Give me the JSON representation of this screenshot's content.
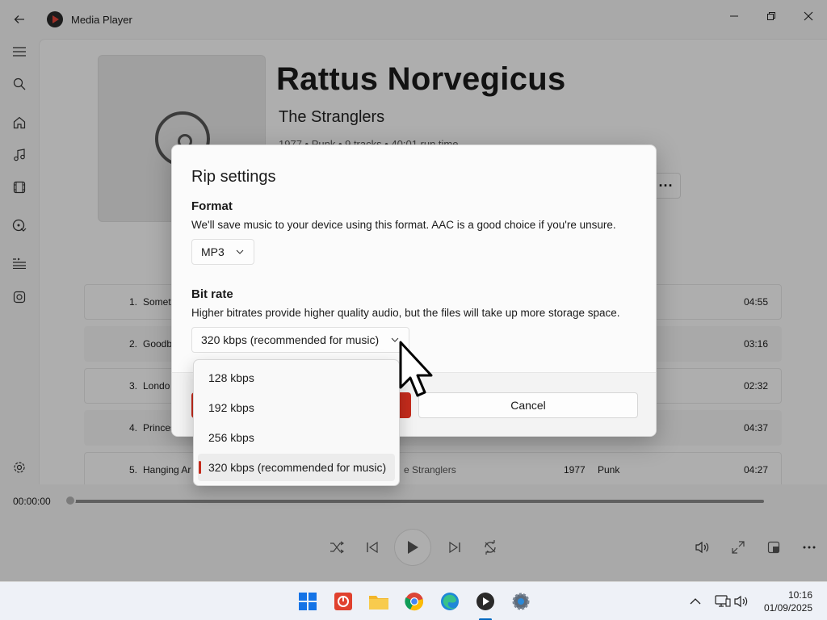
{
  "window": {
    "app_title": "Media Player",
    "back_icon": "back-arrow-icon",
    "controls": [
      "minimize-icon",
      "restore-icon",
      "close-icon"
    ]
  },
  "nav_rail": {
    "items": [
      {
        "name": "menu-icon"
      },
      {
        "name": "search-icon"
      },
      {
        "name": "home-icon"
      },
      {
        "name": "music-icon"
      },
      {
        "name": "video-icon"
      },
      {
        "name": "cd-rip-icon",
        "active": true
      },
      {
        "name": "play-queue-icon"
      },
      {
        "name": "playlists-icon"
      },
      {
        "name": "settings-icon"
      }
    ]
  },
  "album": {
    "title": "Rattus Norvegicus",
    "artist": "The Stranglers",
    "meta": "1977 • Punk • 9 tracks • 40:01 run time"
  },
  "tracks": [
    {
      "num": "1.",
      "name": "Somet",
      "duration": "04:55"
    },
    {
      "num": "2.",
      "name": "Goodb",
      "duration": "03:16"
    },
    {
      "num": "3.",
      "name": "Londo",
      "duration": "02:32"
    },
    {
      "num": "4.",
      "name": "Princes",
      "duration": "04:37"
    },
    {
      "num": "5.",
      "name": "Hanging Ar",
      "artist": "e Stranglers",
      "year": "1977",
      "genre": "Punk",
      "duration": "04:27"
    }
  ],
  "player": {
    "elapsed": "00:00:00"
  },
  "dialog": {
    "title": "Rip settings",
    "format_heading": "Format",
    "format_desc": "We'll save music to your device using this format. AAC is a good choice if you're unsure.",
    "format_value": "MP3",
    "bitrate_heading": "Bit rate",
    "bitrate_desc": "Higher bitrates provide higher quality audio, but the files will take up more storage space.",
    "bitrate_value": "320 kbps (recommended for music)",
    "cancel_label": "Cancel"
  },
  "bitrate_options": [
    {
      "label": "128 kbps"
    },
    {
      "label": "192 kbps"
    },
    {
      "label": "256 kbps"
    },
    {
      "label": "320 kbps (recommended for music)",
      "selected": true
    }
  ],
  "taskbar": {
    "apps": [
      "windows-start-icon",
      "power-app-icon",
      "file-explorer-icon",
      "chrome-icon",
      "edge-icon",
      "media-player-icon",
      "settings-gear-icon"
    ],
    "time": "10:16",
    "date": "01/09/2025"
  },
  "colors": {
    "accent": "#c42b1c",
    "taskbar_accent": "#0067c0"
  }
}
